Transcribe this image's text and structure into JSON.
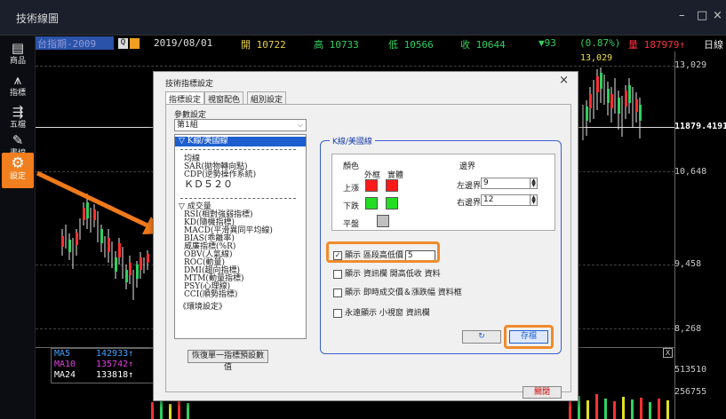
{
  "window": {
    "title": "技術線圖",
    "minimize": "–",
    "restore": "□",
    "close": "×"
  },
  "toolbar": [
    {
      "icon": "▤",
      "label": "商品"
    },
    {
      "icon": "⩚",
      "label": "指標"
    },
    {
      "icon": "⇶",
      "label": "五檔"
    },
    {
      "icon": "✎",
      "label": "畫線"
    },
    {
      "icon": "⚙",
      "label": "設定"
    }
  ],
  "header": {
    "symbol": "台指期-2009",
    "date": "2019/08/01",
    "open": "開 10722",
    "high": "高 10733",
    "low": "低 10566",
    "close": "收 10644",
    "change": "▼93",
    "pct": "(0.87%)",
    "volume": "量 187979↑",
    "period": "日線",
    "colors": {
      "date": "#e0e0e0",
      "open": "#e8d040",
      "high": "#30d060",
      "low": "#30d060",
      "close": "#30d060",
      "change": "#30d060",
      "volume": "#ff3040",
      "period": "#e0e0e0"
    }
  },
  "chart": {
    "price_max_label": "13,029",
    "axis": [
      "13,029",
      "11879.4191",
      "10,648",
      "9,458",
      "8,268"
    ],
    "volume_axis": [
      "513510",
      "256755"
    ],
    "ma": [
      {
        "name": "MA5",
        "value": "142933↑",
        "color": "#40a0ff"
      },
      {
        "name": "MA10",
        "value": "135742↑",
        "color": "#e040e0"
      },
      {
        "name": "MA24",
        "value": "133818↑",
        "color": "#ffffff"
      }
    ],
    "vol_close_box": "X"
  },
  "dialog": {
    "title": "技術指標設定",
    "close": "×",
    "tabs": [
      "指標設定",
      "視窗配色",
      "組別設定"
    ],
    "param_label": "參數設定",
    "group_select": "第1組",
    "list": [
      "▽ K線/美國線",
      "均線",
      "SAR(拋物轉向點)",
      "CDP(逆勢操作系統)",
      "ＫＤ５２０",
      "▽ 成交量",
      "RSI(相對強弱指標)",
      "KD(隨機指標)",
      "MACD(平滑異同平均線)",
      "BIAS(乖離率)",
      "威廉指標(%R)",
      "OBV(人氣線)",
      "ROC(動量)",
      "DMI(趨向指標)",
      "MTM(動量指標)",
      "PSY(心理線)",
      "CCI(順勢指標)",
      "《環境設定》"
    ],
    "reset_button": "恢復單一指標預設數值",
    "group_title": "K線/美國線",
    "color_label": "顏色",
    "outer_label": "外框",
    "body_label": "實體",
    "up_label": "上漲",
    "down_label": "下跌",
    "flat_label": "平盤",
    "border_label": "邊界",
    "left_border_label": "左邊界",
    "left_border_value": "9",
    "right_border_label": "右邊界",
    "right_border_value": "12",
    "opt1": "顯示 區段高低價",
    "opt1_value": "5",
    "opt2": "顯示 資訊欄 開高低收 資料",
    "opt3": "顯示 即時成交價＆漲跌幅 資料框",
    "opt4": "永遠顯示 小視窗 資訊欄",
    "undo_button": "↻",
    "save_button": "存檔",
    "close_button": "關閉",
    "colors": {
      "up_outer": "#ff1a1a",
      "up_body": "#ff1a1a",
      "down_outer": "#22dd22",
      "down_body": "#22dd22",
      "flat": "#c0c0c0"
    }
  }
}
